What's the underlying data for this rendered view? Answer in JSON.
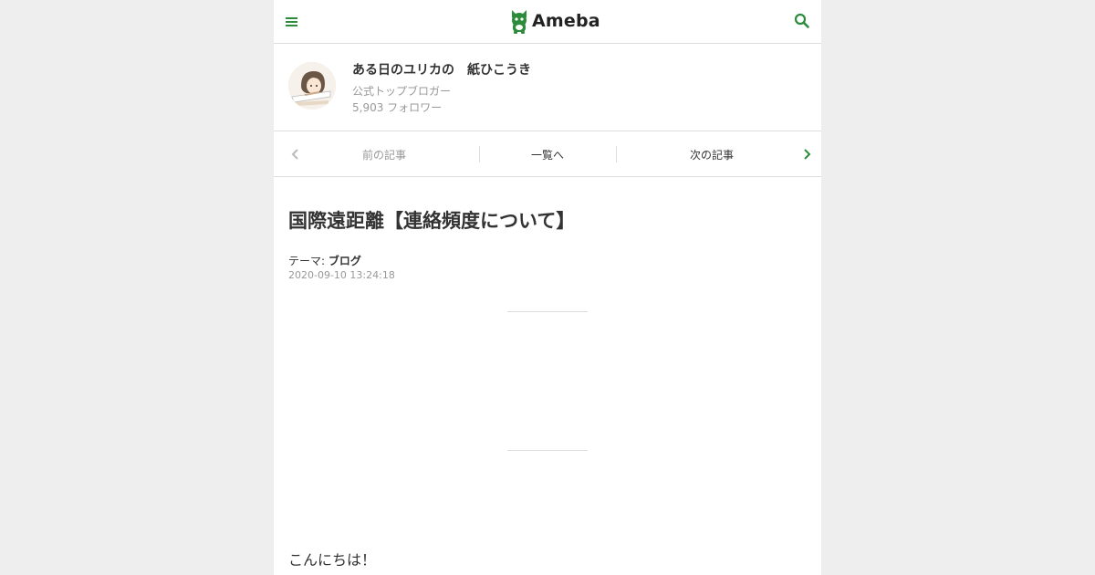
{
  "header": {
    "logo_text": "Ameba",
    "menu_icon": "hamburger-menu-icon",
    "search_icon": "search-icon",
    "accent_color": "#2d8c3c"
  },
  "profile": {
    "blog_title": "ある日のユリカの　紙ひこうき",
    "blogger_rank": "公式トップブロガー",
    "followers": "5,903 フォロワー"
  },
  "article_nav": {
    "prev_label": "前の記事",
    "list_label": "一覧へ",
    "next_label": "次の記事",
    "prev_icon": "chevron-left-icon",
    "next_icon": "chevron-right-icon"
  },
  "article": {
    "title": "国際遠距離【連絡頻度について】",
    "theme_prefix": "テーマ:",
    "theme_name": "ブログ",
    "date": "2020-09-10 13:24:18",
    "first_line": "こんにちは！"
  }
}
